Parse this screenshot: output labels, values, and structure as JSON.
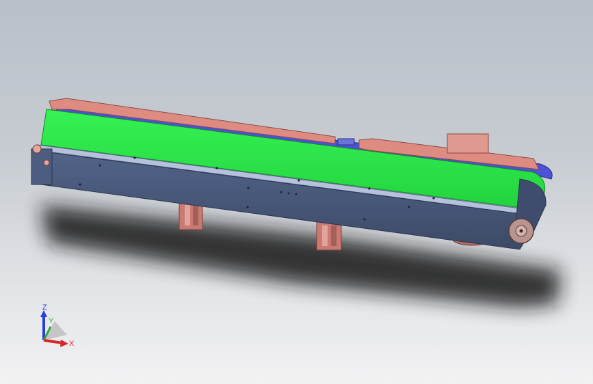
{
  "viewport": {
    "model": "belt-conveyor-assembly",
    "colors": {
      "belt": "#2ee84a",
      "frame": "#4a5a7a",
      "frame_top": "#a9b6d4",
      "guide_rail": "#d9857a",
      "return_belt": "#4a52d6",
      "shadow": "#1a1a1a"
    }
  },
  "triad": {
    "z_label": "Z",
    "y_label": "Y",
    "x_label": "X",
    "colors": {
      "x": "#d6262a",
      "y": "#2fa83a",
      "z": "#2a3fd6"
    }
  }
}
